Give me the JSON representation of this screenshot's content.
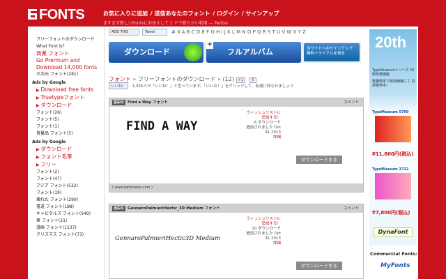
{
  "header": {
    "logo": "FONTS",
    "nav": [
      "お気に入りに追加",
      "送信あなたのフォント",
      "ログイン",
      "サインアップ"
    ],
    "sub": "ますます新しいFontsにお伝えして 1 ドで新たかい利用 — Twitter"
  },
  "toolbar": {
    "bookmark": "ADD THIS",
    "tweet": "Tweet",
    "alphabet": "# 0 A B C D E F G H I J K L M N O P Q R S T U V W X Y Z"
  },
  "sidebar": {
    "top_items": [
      "フリーフォントのダウンロード",
      "What Font is?"
    ],
    "red_items": [
      "商業 フォント",
      "Go Premium and Download 14,000 fonts"
    ],
    "items1": [
      "三次元 フォント(281)"
    ],
    "ads1_title": "Ads by Google",
    "ads1": [
      "Download free fonts",
      "Truetypeフォント",
      "ダウンロード"
    ],
    "items2": [
      "フォント(26)",
      "フォント(5)",
      "フォント(1)",
      "音量品 フォント(5)"
    ],
    "ads2_title": "Ads by Google",
    "ads2": [
      "ダウンロード",
      "フォント毛筆",
      "フリー"
    ],
    "items3": [
      "フォント(2)",
      "フォント(47)",
      "アジア フォント(532)",
      "フォント(19)",
      "壊れた フォント(290)",
      "書道 フォント(188)",
      "キャピタルズ フォント(649)",
      "車 フォント(21)",
      "漫画 フォント(1137)",
      "クリスマス フォント(73)"
    ]
  },
  "banner": {
    "download": "ダウンロード",
    "plus": "+",
    "full_album": "フルアルバム",
    "trial": "当サイトへのサインアップ 無料トライアルを得る"
  },
  "breadcrumb": {
    "root": "フォント",
    "sep": "»",
    "current": "フリーフォントのダウンロード",
    "sep2": "»",
    "count": "(12)",
    "plus1": "+1",
    "zero": "0"
  },
  "likes": {
    "button": "いいね！",
    "text": "1,355人が「いいね！」と言っています。「いいね！」をクリックして、友達に知らせましょう"
  },
  "cards": [
    {
      "tag": "自由な",
      "name": "Find a Way フォント",
      "comment": "コメント",
      "preview": "FIND A WAY",
      "wishlist": "ウィッシュリストに追加する！",
      "downloads": "6 ダウンロード",
      "added": "追加されました Oct 31 2013",
      "details": "詳細",
      "button": "ダウンロードする",
      "source": "( www.tattoowoo.com )"
    },
    {
      "tag": "自由な",
      "name": "GennaroPalmieriHectic_3D Medium フォント",
      "comment": "コメント",
      "preview": "GennaroPalmieriHectic3D Medium",
      "wishlist": "ウィッシュリストに追加する！",
      "downloads": "10 ダウンロード",
      "added": "追加されました Oct 31 2013",
      "details": "詳細",
      "button": "ダウンロードする"
    }
  ],
  "ad": {
    "headline": "20th",
    "sub": "TypeMuseumシリーズ 20周年感謝版",
    "desc": "数量限定で特別価格にて 好評販売中！",
    "product1": "TypeMuseum 5700",
    "price1": "¥11,800円(税込)",
    "product2": "TypeMuseum 3712",
    "price2": "¥7,800円(税込)",
    "brand": "DynaFont"
  },
  "commercial": {
    "title": "Commercial Fonts:",
    "myfonts": "MyFonts"
  }
}
